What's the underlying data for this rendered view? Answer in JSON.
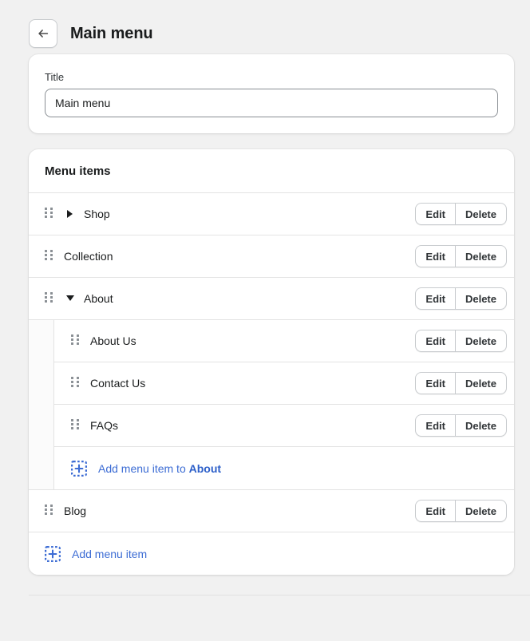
{
  "header": {
    "back_button_icon": "arrow-left-icon",
    "title": "Main menu"
  },
  "title_card": {
    "label": "Title",
    "value": "Main menu",
    "placeholder": "Main menu"
  },
  "menu_card": {
    "section_title": "Menu items",
    "edit_label": "Edit",
    "delete_label": "Delete",
    "drag_handle_icon": "drag-handle-icon",
    "caret_collapsed_icon": "caret-right-icon",
    "caret_expanded_icon": "caret-down-icon",
    "add_icon": "add-square-icon",
    "items": [
      {
        "label": "Shop",
        "expandable": true,
        "expanded": false
      },
      {
        "label": "Collection",
        "expandable": false,
        "expanded": false
      },
      {
        "label": "About",
        "expandable": true,
        "expanded": true,
        "children": [
          {
            "label": "About Us"
          },
          {
            "label": "Contact Us"
          },
          {
            "label": "FAQs"
          }
        ],
        "add_child": {
          "prefix": "Add menu item to ",
          "target": "About"
        }
      },
      {
        "label": "Blog",
        "expandable": false,
        "expanded": false
      }
    ],
    "add_item_label": "Add menu item"
  },
  "colors": {
    "page_background": "#f1f1f1",
    "card_background": "#ffffff",
    "text_primary": "#1a1c1d",
    "border": "#e3e3e3",
    "link_blue": "#3c6cd4",
    "handle_gray": "#8a8f94"
  }
}
